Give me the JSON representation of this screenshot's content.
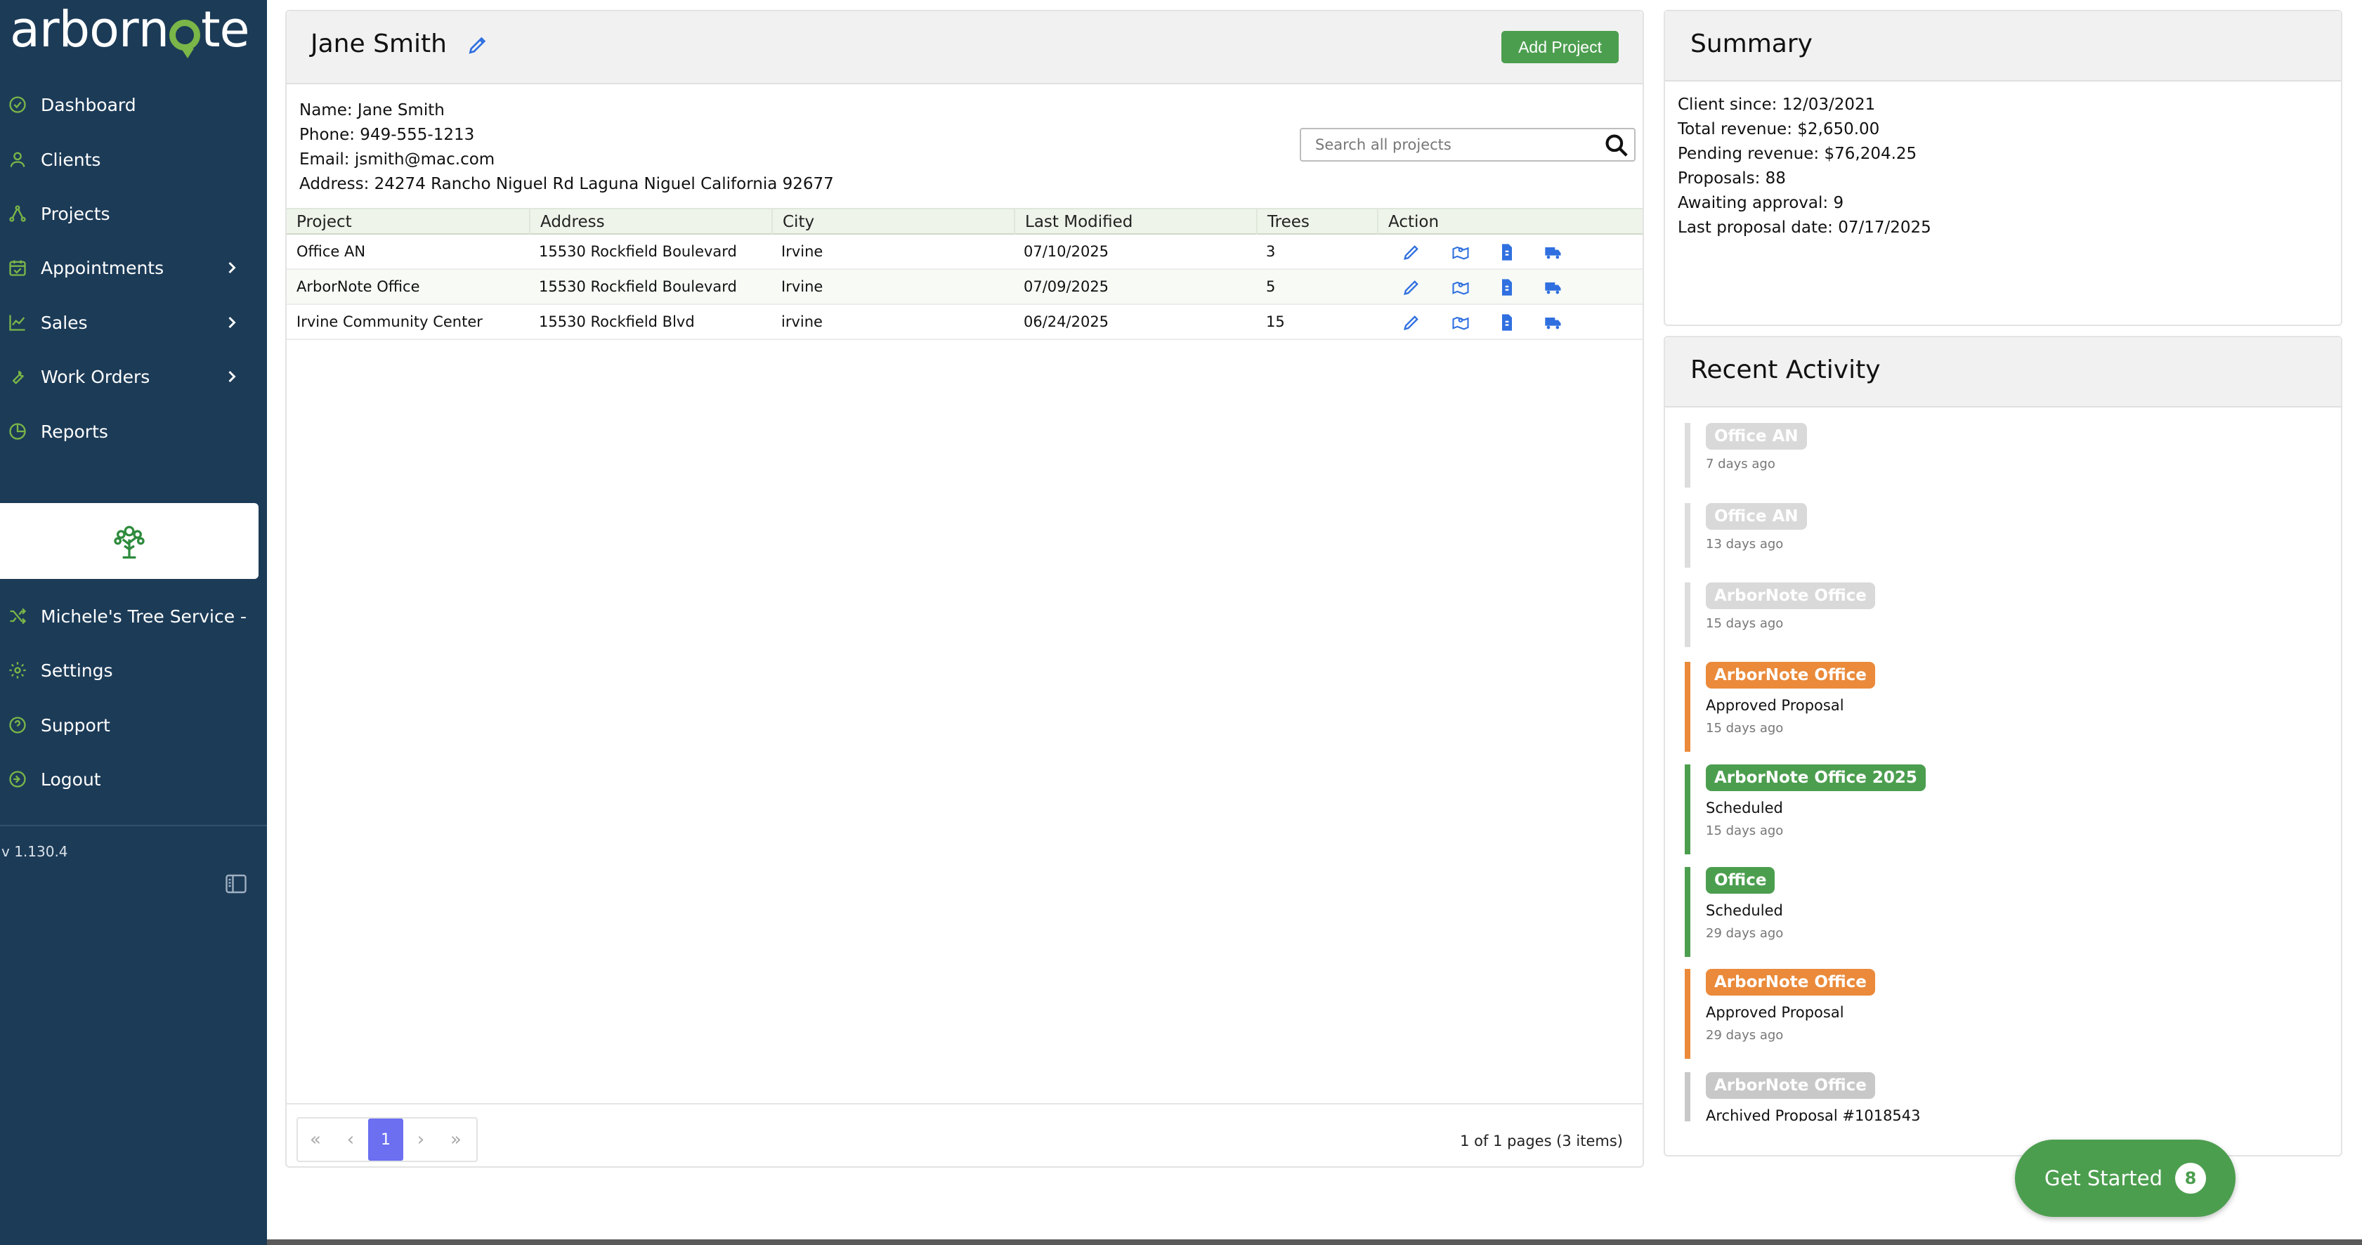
{
  "brand": {
    "logo_text_pre": "arbor",
    "logo_text_post": "te",
    "logo_letter_n": "n",
    "accent": "#7ab648",
    "sidebar_bg": "#1c3b57"
  },
  "sidebar": {
    "items": [
      {
        "label": "Dashboard",
        "icon": "dashboard-icon"
      },
      {
        "label": "Clients",
        "icon": "user-icon"
      },
      {
        "label": "Projects",
        "icon": "projects-icon"
      },
      {
        "label": "Appointments",
        "icon": "calendar-icon"
      },
      {
        "label": "Sales",
        "icon": "chart-icon"
      },
      {
        "label": "Work Orders",
        "icon": "wrench-icon"
      },
      {
        "label": "Reports",
        "icon": "pie-icon"
      }
    ],
    "bottom_items": [
      {
        "label": "Michele's Tree Service -",
        "icon": "shuffle-icon"
      },
      {
        "label": "Settings",
        "icon": "gear-icon"
      },
      {
        "label": "Support",
        "icon": "help-icon"
      },
      {
        "label": "Logout",
        "icon": "logout-icon"
      }
    ],
    "version": "v 1.130.4"
  },
  "client": {
    "name": "Jane Smith",
    "add_project_label": "Add Project",
    "info": {
      "name": "Name: Jane Smith",
      "phone": "Phone: 949-555-1213",
      "email": "Email: jsmith@mac.com",
      "address": "Address: 24274 Rancho Niguel Rd Laguna Niguel California 92677"
    },
    "search_placeholder": "Search all projects"
  },
  "projects": {
    "columns": [
      "Project",
      "Address",
      "City",
      "Last Modified",
      "Trees",
      "Action"
    ],
    "rows": [
      {
        "project": "Office AN",
        "address": "15530 Rockfield Boulevard",
        "city": "Irvine",
        "modified": "07/10/2025",
        "trees": "3"
      },
      {
        "project": "ArborNote Office",
        "address": "15530 Rockfield Boulevard",
        "city": "Irvine",
        "modified": "07/09/2025",
        "trees": "5"
      },
      {
        "project": "Irvine Community Center",
        "address": "15530 Rockfield Blvd",
        "city": "irvine",
        "modified": "06/24/2025",
        "trees": "15"
      }
    ],
    "pager": {
      "current_page": "1",
      "info": "1 of 1 pages (3 items)"
    }
  },
  "summary": {
    "title": "Summary",
    "lines": [
      "Client since: 12/03/2021",
      "Total revenue: $2,650.00",
      "Pending revenue: $76,204.25",
      "Proposals: 88",
      "Awaiting approval: 9",
      "Last proposal date: 07/17/2025"
    ]
  },
  "activity": {
    "title": "Recent Activity",
    "items": [
      {
        "tag": "Office AN",
        "desc": "",
        "time": "7 days ago",
        "color": "#d9d9d9",
        "bar": "#dddddd"
      },
      {
        "tag": "Office AN",
        "desc": "",
        "time": "13 days ago",
        "color": "#d9d9d9",
        "bar": "#dddddd"
      },
      {
        "tag": "ArborNote Office",
        "desc": "",
        "time": "15 days ago",
        "color": "#d9d9d9",
        "bar": "#dddddd"
      },
      {
        "tag": "ArborNote Office",
        "desc": "Approved Proposal",
        "time": "15 days ago",
        "color": "#ea8a3a",
        "bar": "#ea8a3a"
      },
      {
        "tag": "ArborNote Office 2025",
        "desc": "Scheduled",
        "time": "15 days ago",
        "color": "#4c9e4f",
        "bar": "#4c9e4f"
      },
      {
        "tag": "Office",
        "desc": "Scheduled",
        "time": "29 days ago",
        "color": "#4c9e4f",
        "bar": "#4c9e4f"
      },
      {
        "tag": "ArborNote Office",
        "desc": "Approved Proposal",
        "time": "29 days ago",
        "color": "#ea8a3a",
        "bar": "#ea8a3a"
      },
      {
        "tag": "ArborNote Office",
        "desc": "Archived Proposal #1018543",
        "time": "",
        "color": "#c8c8c8",
        "bar": "#c8c8c8"
      }
    ]
  },
  "get_started": {
    "label": "Get Started",
    "count": "8"
  }
}
